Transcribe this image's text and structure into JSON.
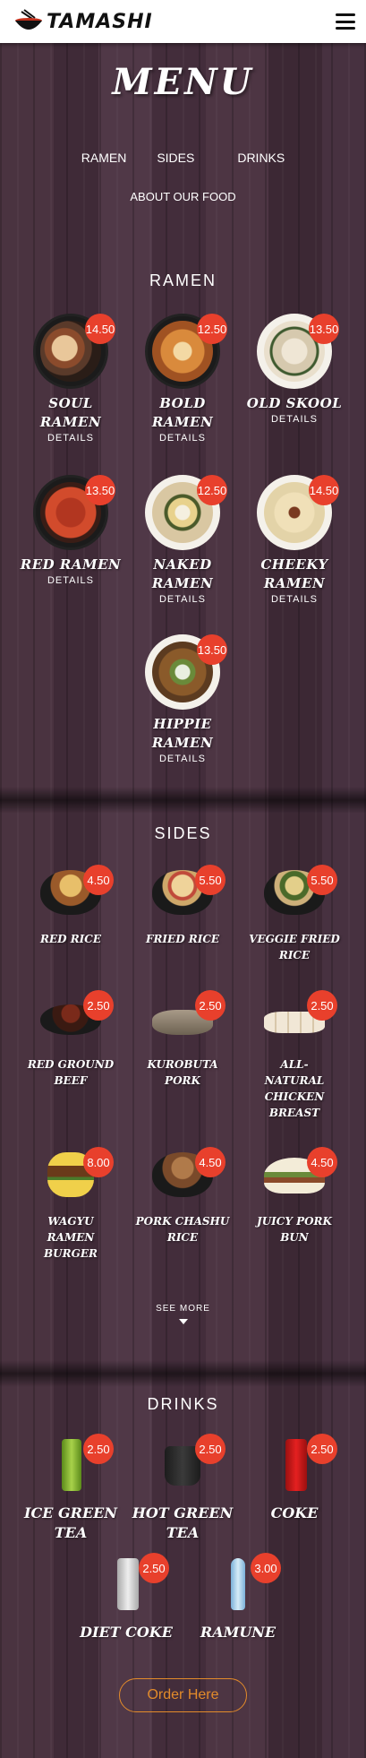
{
  "header": {
    "brand": "TAMASHI"
  },
  "menu_title": "MENU",
  "subnav": [
    "RAMEN",
    "SIDES",
    "DRINKS"
  ],
  "about": "ABOUT OUR FOOD",
  "ramen": {
    "title": "RAMEN",
    "details_label": "DETAILS",
    "items": [
      {
        "name": "SOUL RAMEN",
        "price": "14.50"
      },
      {
        "name": "BOLD RAMEN",
        "price": "12.50"
      },
      {
        "name": "OLD SKOOL",
        "price": "13.50"
      },
      {
        "name": "RED RAMEN",
        "price": "13.50"
      },
      {
        "name": "NAKED RAMEN",
        "price": "12.50"
      },
      {
        "name": "CHEEKY RAMEN",
        "price": "14.50"
      },
      {
        "name": "HIPPIE RAMEN",
        "price": "13.50"
      }
    ]
  },
  "sides": {
    "title": "SIDES",
    "items": [
      {
        "name": "RED RICE",
        "price": "4.50"
      },
      {
        "name": "FRIED RICE",
        "price": "5.50"
      },
      {
        "name": "VEGGIE FRIED RICE",
        "price": "5.50"
      },
      {
        "name": "RED GROUND BEEF",
        "price": "2.50"
      },
      {
        "name": "KUROBUTA PORK",
        "price": "2.50"
      },
      {
        "name": "ALL-NATURAL CHICKEN BREAST",
        "price": "2.50"
      },
      {
        "name": "WAGYU RAMEN BURGER",
        "price": "8.00"
      },
      {
        "name": "PORK CHASHU RICE",
        "price": "4.50"
      },
      {
        "name": "JUICY PORK BUN",
        "price": "4.50"
      }
    ],
    "see_more": "SEE MORE"
  },
  "drinks": {
    "title": "DRINKS",
    "items": [
      {
        "name": "ICE GREEN TEA",
        "price": "2.50"
      },
      {
        "name": "HOT GREEN TEA",
        "price": "2.50"
      },
      {
        "name": "COKE",
        "price": "2.50"
      },
      {
        "name": "DIET COKE",
        "price": "2.50"
      },
      {
        "name": "RAMUNE",
        "price": "3.00"
      }
    ]
  },
  "order_button": "Order Here"
}
